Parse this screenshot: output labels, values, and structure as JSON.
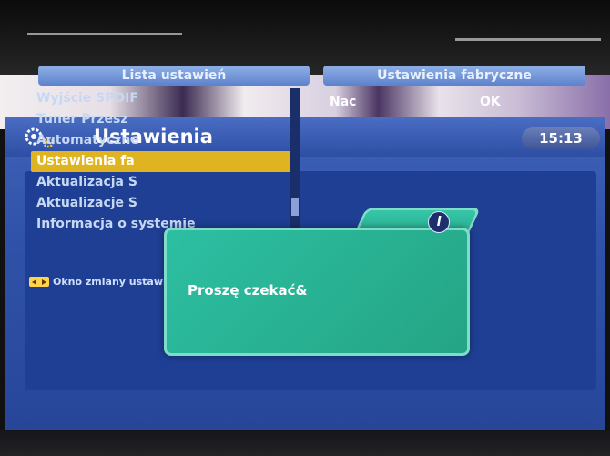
{
  "window": {
    "title": "Ustawienia",
    "clock": "15:13"
  },
  "icons": {
    "settings": "gears-icon",
    "info": "info-icon",
    "navigate": "left-right-arrows-icon"
  },
  "left_panel": {
    "header": "Lista ustawień",
    "items": [
      {
        "label": "Wyjście SPDIF",
        "selected": false
      },
      {
        "label": "Tuner Przesz",
        "selected": false
      },
      {
        "label": "Automatyczne",
        "selected": false
      },
      {
        "label": "Ustawienia fa",
        "selected": true
      },
      {
        "label": "Aktualizacja S",
        "selected": false
      },
      {
        "label": "Aktualizacje S",
        "selected": false
      },
      {
        "label": "Informacja o systemie",
        "selected": false
      }
    ]
  },
  "right_panel": {
    "header": "Ustawienia fabryczne",
    "line_left": "Nac",
    "line_right": "OK"
  },
  "footer": {
    "hint": "Okno zmiany ustawień"
  },
  "popup": {
    "message": "Proszę czekać&",
    "info_symbol": "i"
  },
  "colors": {
    "menu_blue": "#2f52a8",
    "highlight": "#e0b320",
    "popup_green": "#2dbfa2"
  }
}
